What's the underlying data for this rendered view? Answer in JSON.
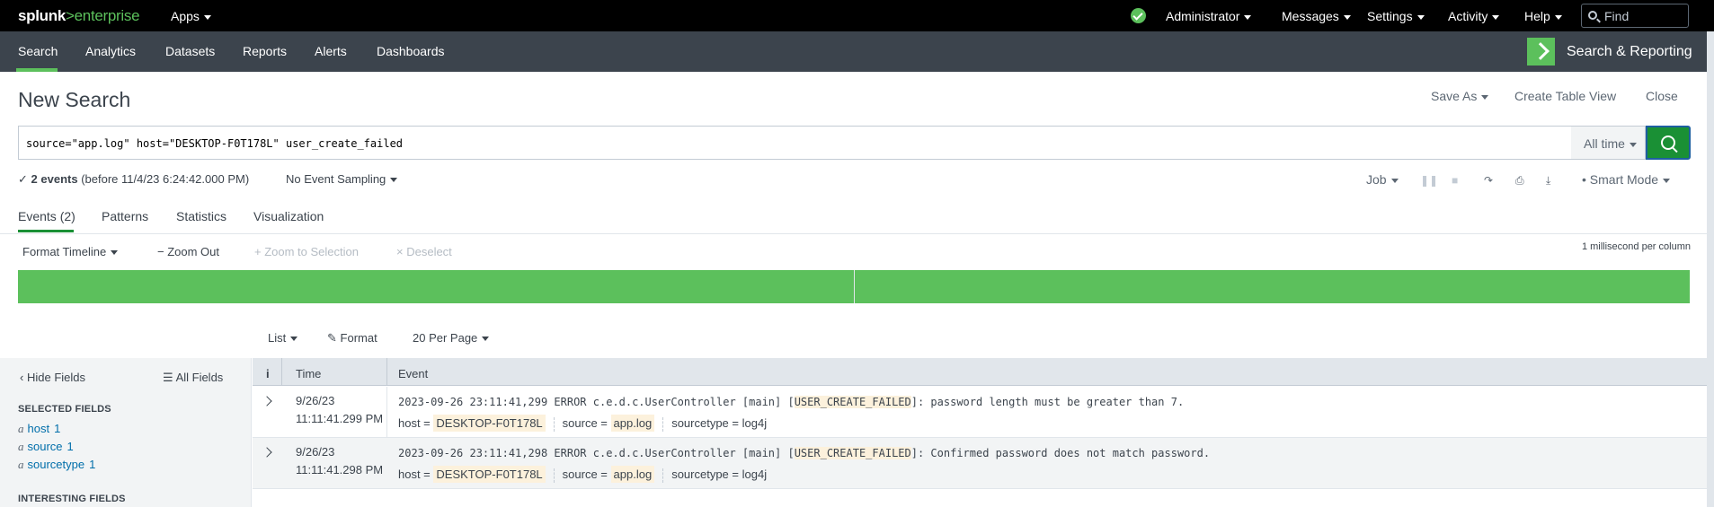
{
  "topbar": {
    "logo_main": "splunk",
    "logo_gt": ">",
    "logo_sub": "enterprise",
    "apps": "Apps",
    "user": "Administrator",
    "messages": "Messages",
    "settings": "Settings",
    "activity": "Activity",
    "help": "Help",
    "find_placeholder": "Find",
    "status_icon": "check-circle-icon",
    "status_color": "#5cc05c"
  },
  "appnav": {
    "tabs": [
      "Search",
      "Analytics",
      "Datasets",
      "Reports",
      "Alerts",
      "Dashboards"
    ],
    "active_tab": "Search",
    "app_title": "Search & Reporting",
    "accent": "#5cc05c"
  },
  "page": {
    "title": "New Search",
    "save_as": "Save As",
    "create_table_view": "Create Table View",
    "close": "Close"
  },
  "search": {
    "query": "source=\"app.log\" host=\"DESKTOP-F0T178L\" user_create_failed",
    "time_range": "All time",
    "button_color": "#1a9035"
  },
  "job": {
    "check": "✓",
    "event_count": "2 events",
    "before": "(before 11/4/23 6:24:42.000 PM)",
    "sampling": "No Event Sampling",
    "job_menu": "Job",
    "mode": "Smart Mode"
  },
  "results_tabs": [
    "Events (2)",
    "Patterns",
    "Statistics",
    "Visualization"
  ],
  "timeline": {
    "format": "Format Timeline",
    "zoom_out": "Zoom Out",
    "zoom_selection": "Zoom to Selection",
    "deselect": "Deselect",
    "scale": "1 millisecond per column",
    "bar_color": "#5cc05c"
  },
  "results_toolbar": {
    "view": "List",
    "format": "Format",
    "per_page": "20 Per Page"
  },
  "sidebar": {
    "hide_fields": "Hide Fields",
    "all_fields": "All Fields",
    "selected_heading": "SELECTED FIELDS",
    "selected_fields": [
      {
        "type": "a",
        "name": "host",
        "count": "1"
      },
      {
        "type": "a",
        "name": "source",
        "count": "1"
      },
      {
        "type": "a",
        "name": "sourcetype",
        "count": "1"
      }
    ],
    "interesting_heading": "INTERESTING FIELDS"
  },
  "table": {
    "col_info": "i",
    "col_time": "Time",
    "col_event": "Event",
    "rows": [
      {
        "date": "9/26/23",
        "time": "11:11:41.299 PM",
        "raw_pre": "2023-09-26 23:11:41,299 ERROR c.e.d.c.UserController [main] [",
        "raw_hl": "USER_CREATE_FAILED",
        "raw_post": "]: password length must be greater than 7.",
        "host_label": "host =",
        "host": "DESKTOP-F0T178L",
        "source_label": "source =",
        "source": "app.log",
        "sourcetype_label": "sourcetype =",
        "sourcetype": "log4j"
      },
      {
        "date": "9/26/23",
        "time": "11:11:41.298 PM",
        "raw_pre": "2023-09-26 23:11:41,298 ERROR c.e.d.c.UserController [main] [",
        "raw_hl": "USER_CREATE_FAILED",
        "raw_post": "]: Confirmed password does not match password.",
        "host_label": "host =",
        "host": "DESKTOP-F0T178L",
        "source_label": "source =",
        "source": "app.log",
        "sourcetype_label": "sourcetype =",
        "sourcetype": "log4j"
      }
    ]
  }
}
